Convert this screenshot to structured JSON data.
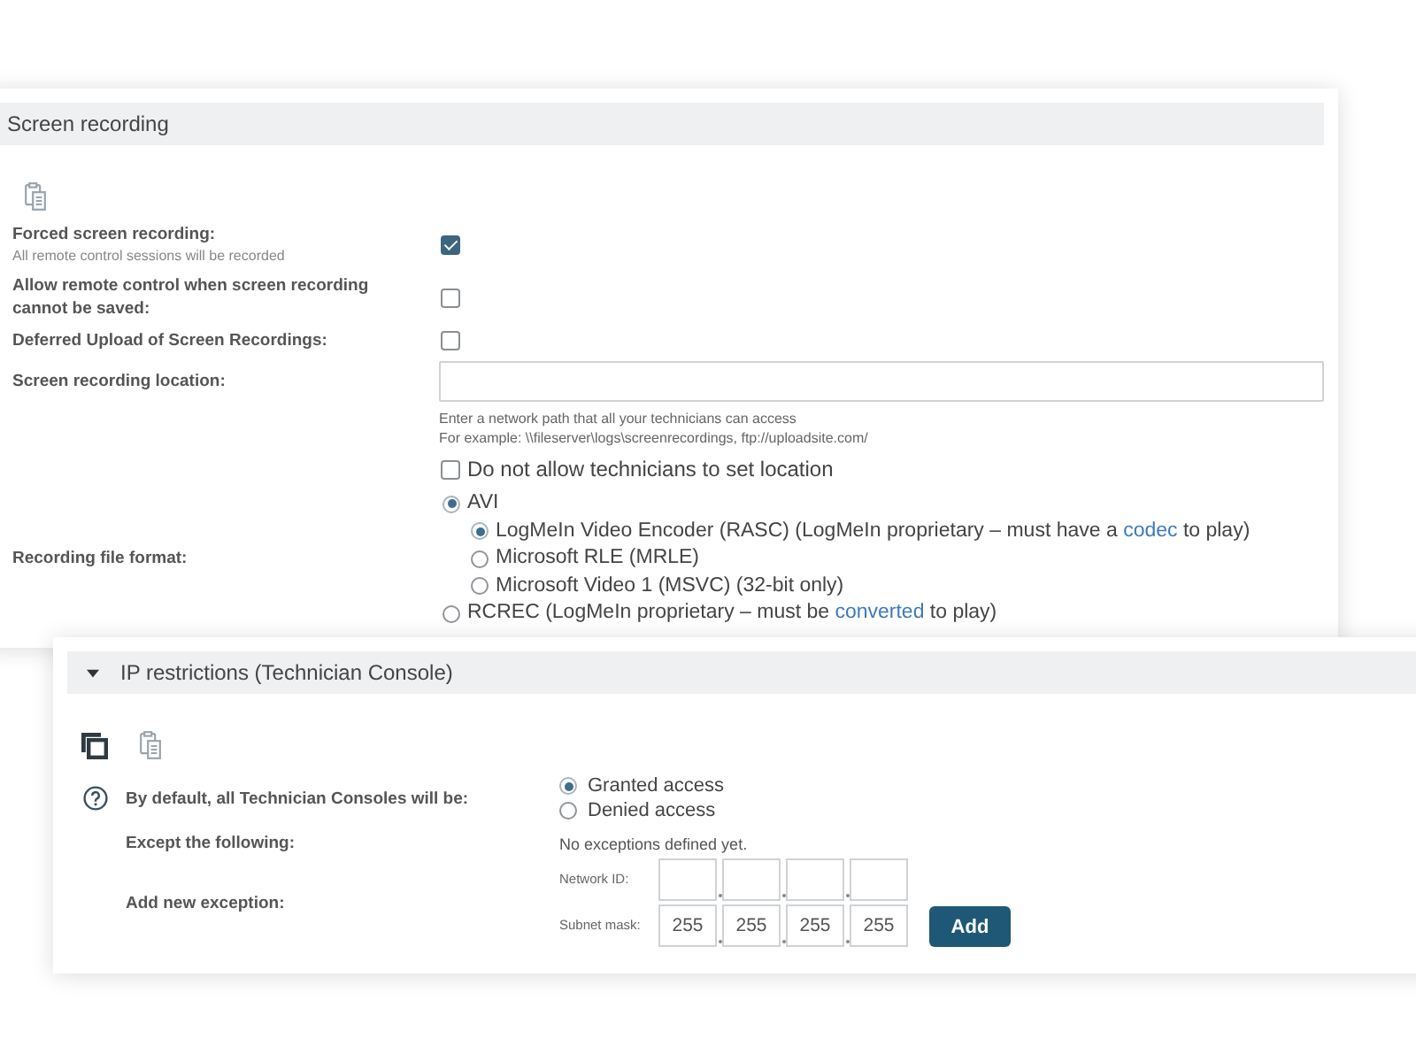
{
  "screen_recording": {
    "title": "Screen recording",
    "settings": [
      {
        "kind": "checkbox",
        "label": "Forced screen recording:",
        "description": "All remote control sessions will be recorded",
        "checked": true
      },
      {
        "kind": "checkbox",
        "label": "Allow remote control when screen recording cannot be saved:",
        "checked": false
      },
      {
        "kind": "checkbox",
        "label": "Deferred Upload of Screen Recordings:",
        "checked": false
      },
      {
        "kind": "text_field",
        "label": "Screen recording location:",
        "hints": [
          "Enter a network path that all your technicians can access",
          "For example: \\\\fileserver\\logs\\screenrecordings, ftp://uploadsite.com/"
        ],
        "option": {
          "label": "Do not allow technicians to set location",
          "checked": false
        }
      },
      {
        "kind": "radio_group",
        "label": "Recording file format:",
        "options": [
          {
            "label": "AVI",
            "selected": true,
            "children": [
              {
                "label": "LogMeIn Video Encoder (RASC) (LogMeIn proprietary – must have a ",
                "link": "codec",
                "label_after": " to play)",
                "selected": true
              },
              {
                "label": "Microsoft RLE (MRLE)",
                "selected": false
              },
              {
                "label": "Microsoft Video 1 (MSVC) (32-bit only)",
                "selected": false
              }
            ]
          },
          {
            "label": "RCREC (LogMeIn proprietary – must be ",
            "link": "converted",
            "label_after": " to play)",
            "selected": false
          }
        ]
      }
    ]
  },
  "ip_restrictions": {
    "title": "IP restrictions (Technician Console)",
    "expanded": true,
    "rows": [
      {
        "kind": "radio_group",
        "label": "By default, all Technician Consoles will be:",
        "help": true,
        "options": [
          {
            "label": "Granted access",
            "selected": true
          },
          {
            "label": "Denied access",
            "selected": false
          }
        ]
      },
      {
        "kind": "text",
        "label": "Except the following:",
        "value": "No exceptions defined yet."
      },
      {
        "kind": "ip_entry",
        "label": "Add new exception:",
        "fields": [
          {
            "label": "Network ID:"
          },
          {
            "label": "Subnet mask:",
            "octets": [
              "255",
              "255",
              "255",
              "255"
            ]
          }
        ],
        "button": "Add"
      }
    ]
  }
}
